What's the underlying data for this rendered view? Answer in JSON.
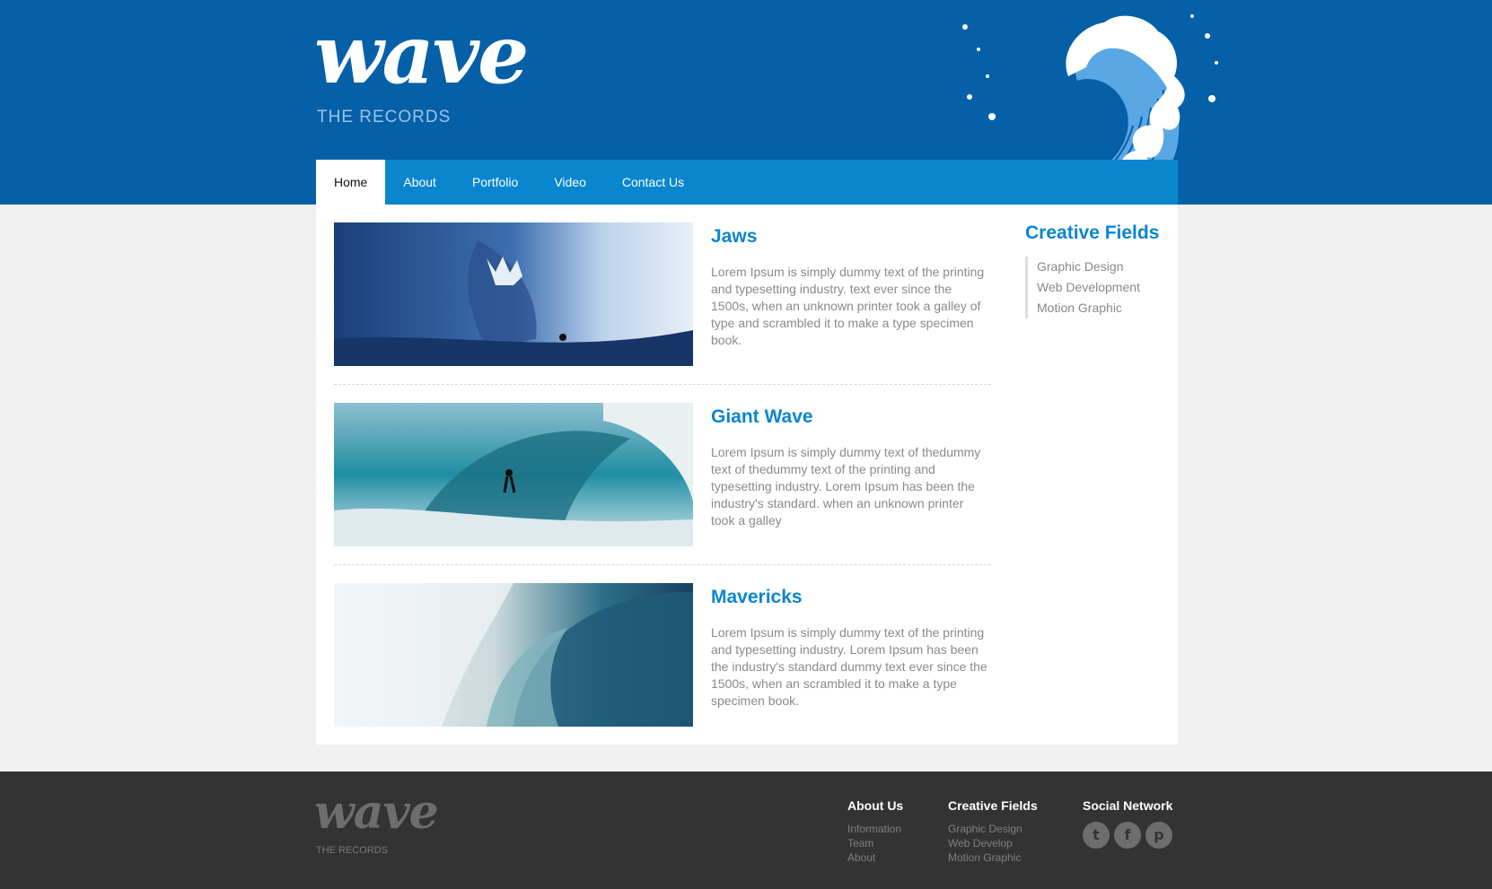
{
  "header": {
    "logo": "wave",
    "tagline": "THE RECORDS"
  },
  "nav": {
    "items": [
      {
        "label": "Home",
        "active": true
      },
      {
        "label": "About"
      },
      {
        "label": "Portfolio"
      },
      {
        "label": "Video"
      },
      {
        "label": "Contact Us"
      }
    ]
  },
  "posts": [
    {
      "title": "Jaws",
      "text": "Lorem Ipsum is simply dummy text of the printing and typesetting industry. text ever since the 1500s, when an unknown printer took a galley of type and scrambled it to make a type specimen book."
    },
    {
      "title": "Giant Wave",
      "text": "Lorem Ipsum is simply dummy text of thedummy text of thedummy text of the printing and typesetting industry. Lorem Ipsum has been the industry's standard. when an unknown printer took a galley"
    },
    {
      "title": "Mavericks",
      "text": "Lorem Ipsum is simply dummy text of the printing and typesetting industry. Lorem Ipsum has been the industry's standard dummy text ever since the 1500s, when an scrambled it to make a type specimen book."
    }
  ],
  "sidebar": {
    "title": "Creative Fields",
    "items": [
      "Graphic Design",
      "Web Development",
      "Motion Graphic"
    ]
  },
  "footer": {
    "logo": "wave",
    "tagline": "THE RECORDS",
    "about": {
      "title": "About Us",
      "links": [
        "Information",
        "Team",
        "About"
      ]
    },
    "creative": {
      "title": "Creative Fields",
      "links": [
        "Graphic Design",
        "Web Develop",
        "Motion Graphic"
      ]
    },
    "social": {
      "title": "Social Network",
      "icons": [
        "twitter-icon",
        "facebook-icon",
        "pinterest-icon"
      ]
    }
  },
  "colors": {
    "header_bg": "#0560a8",
    "nav_bg": "#0a86cf",
    "accent": "#0a86cf",
    "footer_bg": "#333333"
  }
}
